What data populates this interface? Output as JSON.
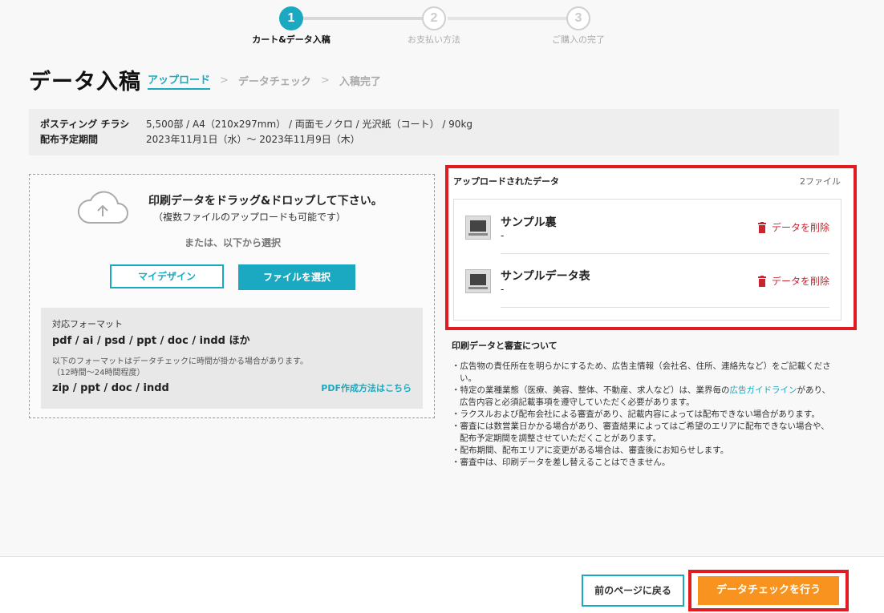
{
  "stepper": {
    "steps": [
      {
        "number": "1",
        "label": "カート&データ入稿"
      },
      {
        "number": "2",
        "label": "お支払い方法"
      },
      {
        "number": "3",
        "label": "ご購入の完了"
      }
    ]
  },
  "header": {
    "title": "データ入稿",
    "breadcrumbs": [
      "アップロード",
      "データチェック",
      "入稿完了"
    ],
    "separator": ">"
  },
  "summary": {
    "product_label": "ポスティング チラシ",
    "product_value": "5,500部 /  A4（210x297mm） / 両面モノクロ / 光沢紙（コート） / 90kg",
    "period_label": "配布予定期間",
    "period_value": "2023年11月1日（水）～ 2023年11月9日（木）"
  },
  "dropzone": {
    "title": "印刷データをドラッグ&ドロップして下さい。",
    "subtitle": "（複数ファイルのアップロードも可能です）",
    "or_text": "または、以下から選択",
    "mydesign_button": "マイデザイン",
    "file_button": "ファイルを選択",
    "formats_label": "対応フォーマット",
    "formats_list": "pdf / ai / psd / ppt / doc / indd ほか",
    "slow_note": "以下のフォーマットはデータチェックに時間が掛かる場合があります。",
    "slow_note_time": "（12時間～24時間程度）",
    "slow_formats": "zip / ppt / doc / indd",
    "pdf_link": "PDF作成方法はこちら"
  },
  "uploaded": {
    "title": "アップロードされたデータ",
    "count": "2ファイル",
    "files": [
      {
        "name": "サンプル裏",
        "meta": "-",
        "delete": "データを削除"
      },
      {
        "name": "サンプルデータ表",
        "meta": "-",
        "delete": "データを削除"
      }
    ]
  },
  "notes": {
    "title": "印刷データと審査について",
    "items": [
      "・広告物の責任所在を明らかにするため、広告主情報（会社名、住所、連絡先など）をご記載ください。",
      "・特定の業種業態（医療、美容、整体、不動産、求人など）は、業界毎の",
      "・ラクスルおよび配布会社による審査があり、記載内容によっては配布できない場合があります。",
      "・審査には数営業日かかる場合があり、審査結果によってはご希望のエリアに配布できない場合や、配布予定期間を調整させていただくことがあります。",
      "・配布期間、配布エリアに変更がある場合は、審査後にお知らせします。",
      "・審査中は、印刷データを差し替えることはできません。"
    ],
    "link_text": "広告ガイドライン",
    "item2_suffix": "があり、広告内容と必須記載事項を遵守していただく必要があります。"
  },
  "footer": {
    "back_button": "前のページに戻る",
    "check_button": "データチェックを行う"
  },
  "colors": {
    "accent": "#1aa9c0",
    "inactive": "#cccccc",
    "primary_cta": "#f7931e",
    "delete": "#c8252f",
    "highlight": "#e01b22"
  }
}
